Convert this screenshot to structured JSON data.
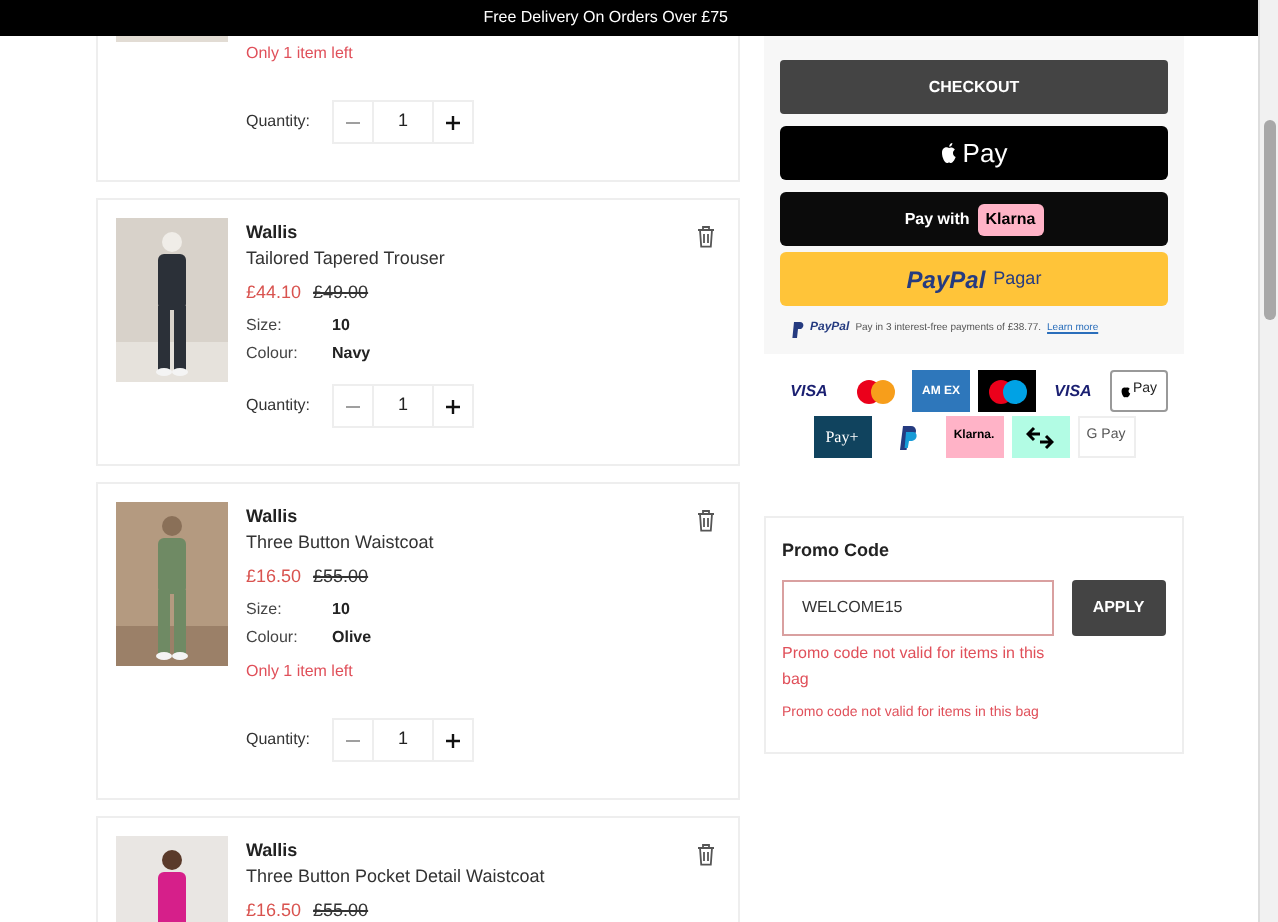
{
  "banner": {
    "text": "Free Delivery On Orders Over £75"
  },
  "items": [
    {
      "stock_note": "Only 1 item left",
      "quantity_label": "Quantity:",
      "quantity": "1"
    },
    {
      "brand": "Wallis",
      "name": "Tailored Tapered Trouser",
      "price": "£44.10",
      "was_price": "£49.00",
      "size_label": "Size:",
      "size": "10",
      "colour_label": "Colour:",
      "colour": "Navy",
      "quantity_label": "Quantity:",
      "quantity": "1"
    },
    {
      "brand": "Wallis",
      "name": "Three Button Waistcoat",
      "price": "£16.50",
      "was_price": "£55.00",
      "size_label": "Size:",
      "size": "10",
      "colour_label": "Colour:",
      "colour": "Olive",
      "stock_note": "Only 1 item left",
      "quantity_label": "Quantity:",
      "quantity": "1"
    },
    {
      "brand": "Wallis",
      "name": "Three Button Pocket Detail Waistcoat",
      "price": "£16.50",
      "was_price": "£55.00"
    }
  ],
  "summary": {
    "checkout": "CHECKOUT",
    "apple_pay": "Pay",
    "klarna_prefix": "Pay with",
    "klarna": "Klarna",
    "paypal_logo": "PayPal",
    "paypal_label": "Pagar",
    "paypal_note_logo": "PayPal",
    "paypal_note": "Pay in 3 interest-free payments of £38.77.",
    "paypal_note_link": "Learn more"
  },
  "payment_methods": [
    {
      "kind": "visa",
      "label": "VISA"
    },
    {
      "kind": "mastercard"
    },
    {
      "kind": "amex",
      "label": "AM EX"
    },
    {
      "kind": "maestro"
    },
    {
      "kind": "visa_electron",
      "label": "VISA"
    },
    {
      "kind": "applepay",
      "label": "Pay"
    },
    {
      "kind": "payplus",
      "label": "Pay+"
    },
    {
      "kind": "paypal"
    },
    {
      "kind": "klarna",
      "label": "Klarna."
    },
    {
      "kind": "clearpay"
    },
    {
      "kind": "gpay",
      "label": "G Pay"
    }
  ],
  "promo": {
    "title": "Promo Code",
    "value": "WELCOME15",
    "button": "APPLY",
    "error": "Promo code not valid for items in this bag",
    "error_2": "Promo code not valid for items in this bag"
  }
}
